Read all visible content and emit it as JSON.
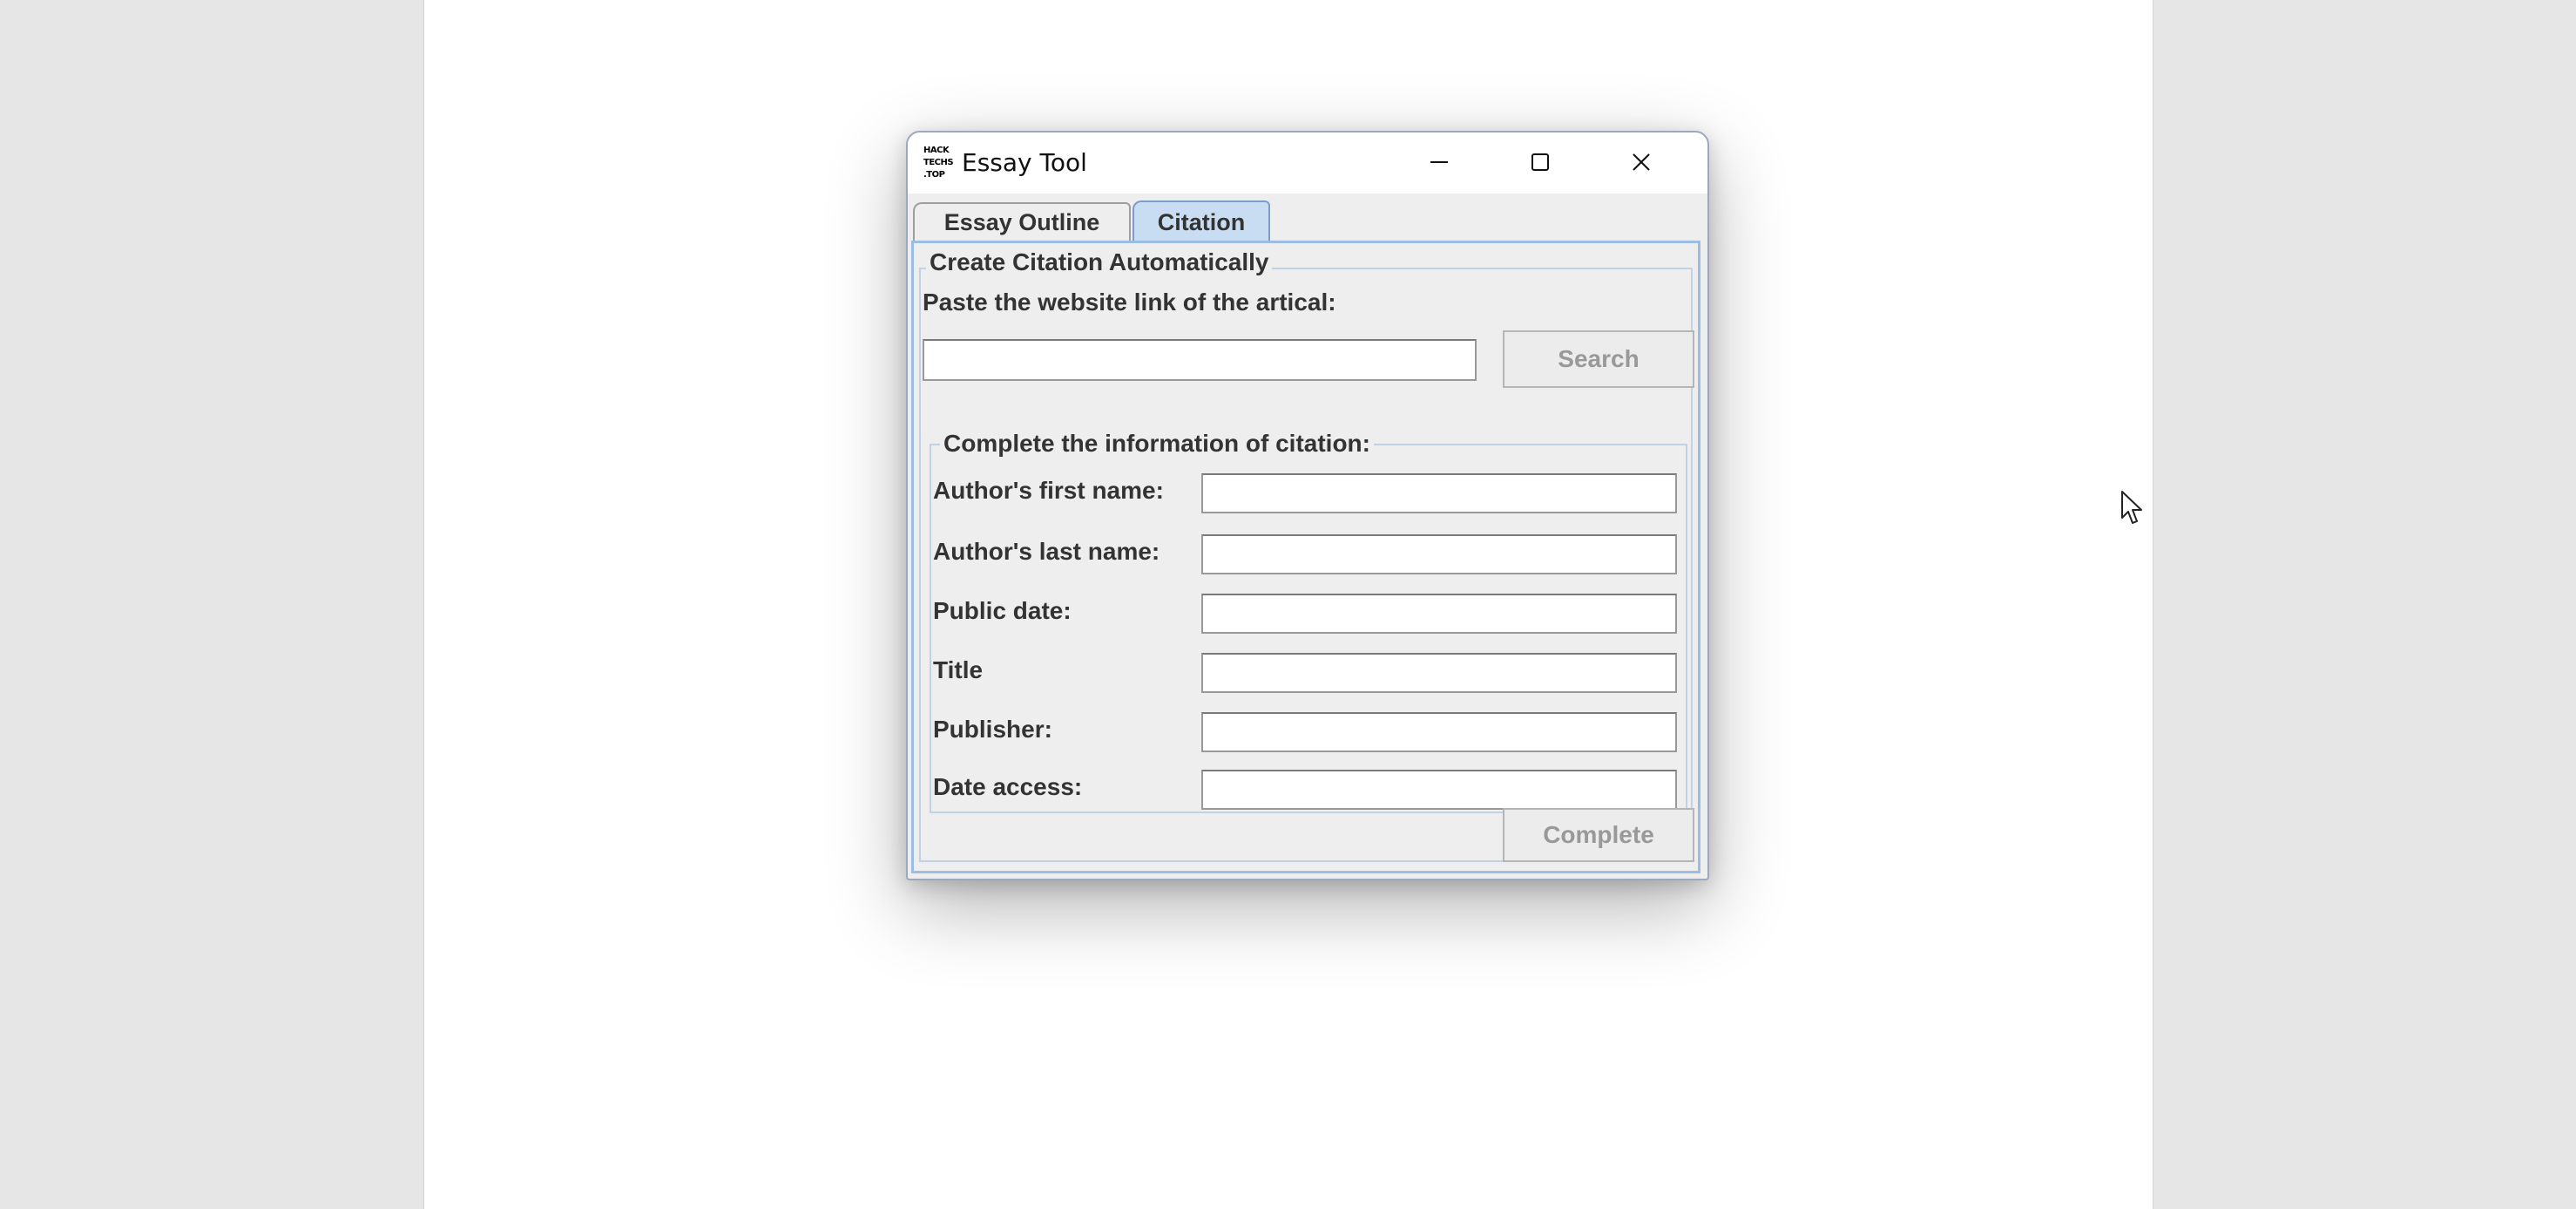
{
  "window": {
    "title": "Essay Tool",
    "logo_lines": [
      "HACK",
      "TECHS",
      ".TOP"
    ]
  },
  "tabs": [
    {
      "label": "Essay Outline",
      "selected": false
    },
    {
      "label": "Citation",
      "selected": true
    }
  ],
  "citation": {
    "group_title": "Create Citation Automatically",
    "paste_label": "Paste the website link of the artical:",
    "url_value": "",
    "search_label": "Search",
    "info_group_title": "Complete the information of citation:",
    "fields": [
      {
        "label": "Author's first name:",
        "value": ""
      },
      {
        "label": "Author's last name:",
        "value": ""
      },
      {
        "label": "Public date:",
        "value": ""
      },
      {
        "label": "Title",
        "value": ""
      },
      {
        "label": "Publisher:",
        "value": ""
      },
      {
        "label": "Date access:",
        "value": ""
      }
    ],
    "complete_label": "Complete"
  },
  "colors": {
    "background": "#e6e6e6",
    "window": "#eeeeee",
    "selected_tab": "#c9ddf2",
    "disabled_text": "#999999"
  },
  "icons": [
    "minimize-icon",
    "maximize-icon",
    "close-icon",
    "mouse-cursor-icon"
  ]
}
